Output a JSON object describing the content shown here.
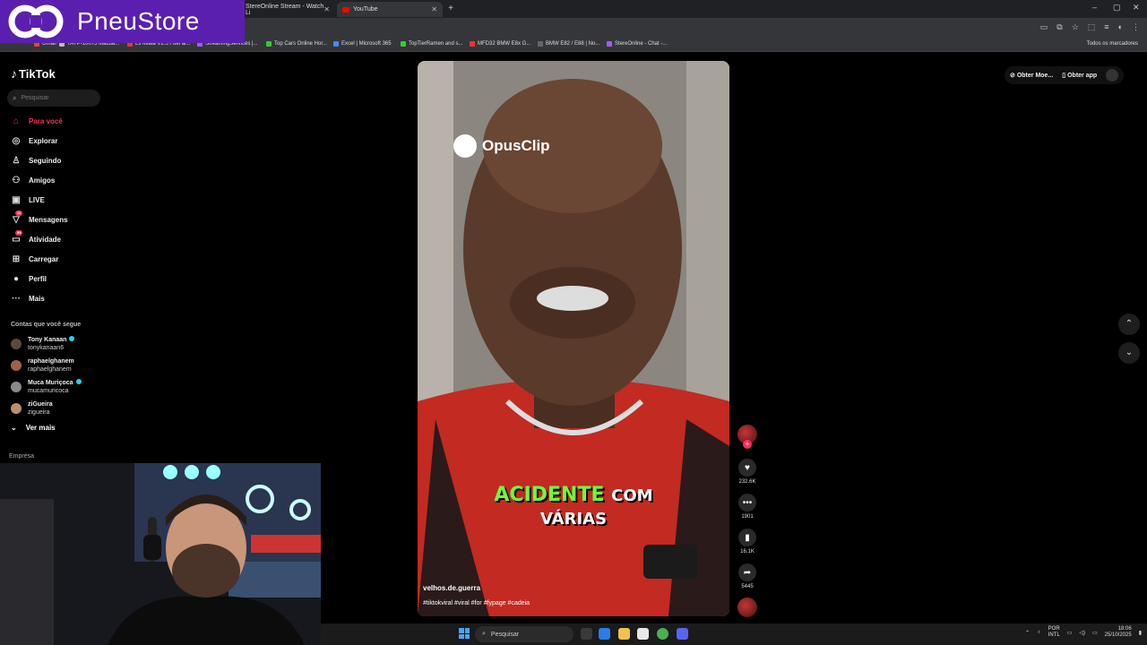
{
  "browser": {
    "tabs": [
      {
        "label": "StereOnline Stream - Watch Li"
      },
      {
        "label": "YouTube"
      }
    ],
    "new_tab": "+",
    "window_controls": [
      "–",
      "▢",
      "✕"
    ],
    "bookmarks": [
      "Gmail",
      "TAYP-10075 Mazda...",
      "Ls Miata V2.5 Fuel ai...",
      "StreamingServices |...",
      "Top Cars Online Hor...",
      "Excel | Microsoft 365",
      "TopTierRamen and s...",
      "MFD32 BMW E8x G...",
      "BMW E82 / E88 | No...",
      "StereOnline - Chat -..."
    ],
    "all_bookmarks": "Todos os marcadores"
  },
  "overlay": {
    "brand": "PneuStore"
  },
  "tiktok": {
    "logo": "TikTok",
    "search_placeholder": "Pesquisar",
    "nav": [
      {
        "label": "Para você",
        "icon": "home-icon"
      },
      {
        "label": "Explorar",
        "icon": "compass-icon"
      },
      {
        "label": "Seguindo",
        "icon": "following-icon"
      },
      {
        "label": "Amigos",
        "icon": "friends-icon"
      },
      {
        "label": "LIVE",
        "icon": "live-icon"
      },
      {
        "label": "Mensagens",
        "icon": "message-icon",
        "badge": "11"
      },
      {
        "label": "Atividade",
        "icon": "activity-icon",
        "badge": "99"
      },
      {
        "label": "Carregar",
        "icon": "upload-icon"
      },
      {
        "label": "Perfil",
        "icon": "profile-icon"
      },
      {
        "label": "Mais",
        "icon": "more-icon"
      }
    ],
    "following_title": "Contas que você segue",
    "following": [
      {
        "name": "Tony Kanaan",
        "handle": "tonykanaan6",
        "verified": true
      },
      {
        "name": "raphaelghanem",
        "handle": "raphaelghanem",
        "verified": false
      },
      {
        "name": "Muca Muriçoca",
        "handle": "mucamuricoca",
        "verified": true
      },
      {
        "name": "ziGueira",
        "handle": "zigueira",
        "verified": false
      }
    ],
    "see_more": "Ver mais",
    "company": "Empresa",
    "top_right": {
      "coins": "Obter Moe...",
      "get_app": "Obter app"
    }
  },
  "video": {
    "watermark": "OpusClip",
    "caption_word1": "ACIDENTE",
    "caption_word2": "COM",
    "caption_line2": "VÁRIAS",
    "author": "velhos.de.guerra",
    "tags": "#tiktokviral #viral #for #fypage #cadeia",
    "likes": "232.6K",
    "comments": "1901",
    "saves": "16.1K",
    "shares": "5445"
  },
  "taskbar": {
    "search": "Pesquisar",
    "lang_top": "POR",
    "lang_bottom": "INTL",
    "time": "18:06",
    "date": "25/10/2025"
  },
  "colors": {
    "accent": "#fe2c55",
    "overlay_brand": "#5b1fb0",
    "caption_green": "#6dff3a"
  }
}
